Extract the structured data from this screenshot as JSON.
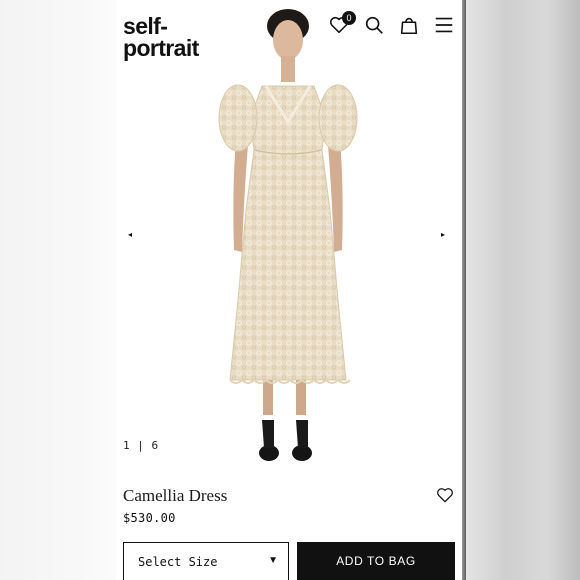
{
  "brand": {
    "line1": "self-",
    "line2": "portrait"
  },
  "header": {
    "wishlist_count": "0",
    "icons": [
      "heart-icon",
      "search-icon",
      "bag-icon",
      "menu-icon"
    ]
  },
  "gallery": {
    "current": "1",
    "separator": "|",
    "total": "6",
    "prev_glyph": "◂",
    "next_glyph": "▸"
  },
  "product": {
    "name": "Camellia Dress",
    "price": "$530.00"
  },
  "actions": {
    "size_label": "Select Size",
    "size_caret": "▼",
    "add_label": "ADD TO BAG"
  },
  "colors": {
    "text": "#111111",
    "dress": "#efe4cf",
    "button_bg": "#111111"
  }
}
